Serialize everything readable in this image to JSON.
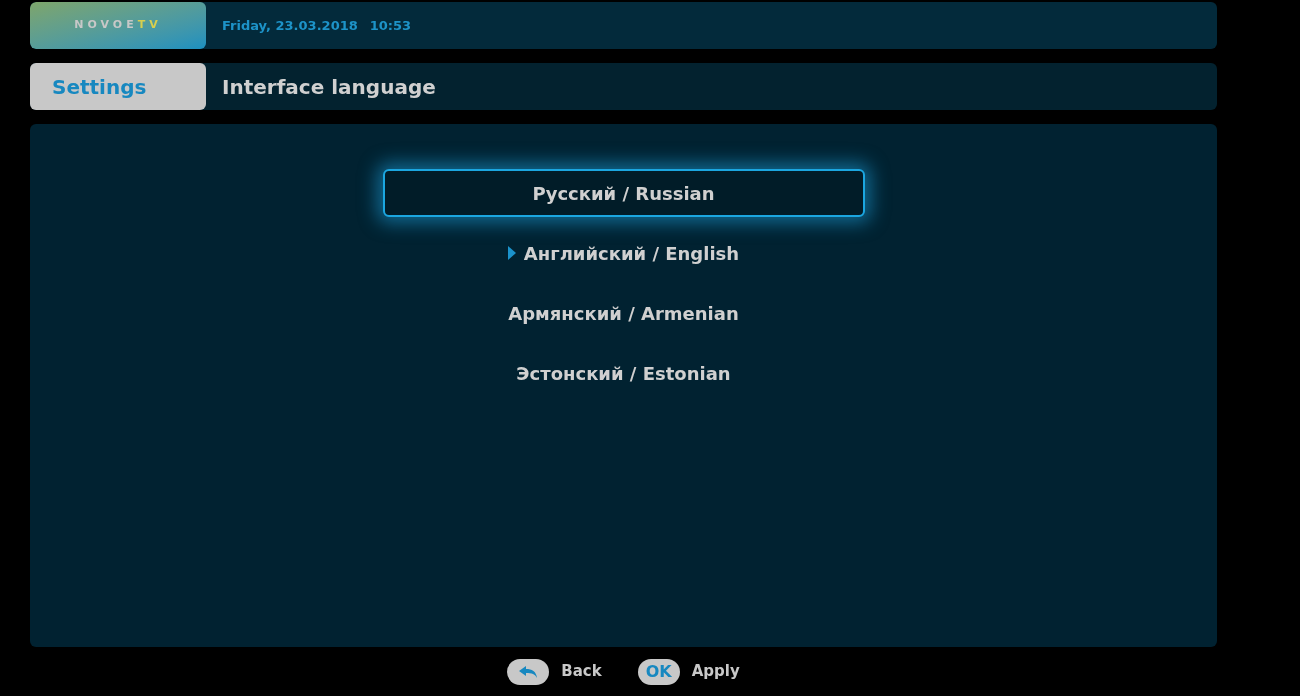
{
  "top_bar": {
    "logo": {
      "part_1": "NOVOE",
      "part_2": "TV"
    },
    "date": "Friday, 23.03.2018",
    "time": "10:53"
  },
  "header": {
    "section": "Settings",
    "title": "Interface language"
  },
  "languages": [
    {
      "label": "Русский / Russian",
      "focused": true,
      "current": false
    },
    {
      "label": "Английский / English",
      "focused": false,
      "current": true
    },
    {
      "label": "Армянский / Armenian",
      "focused": false,
      "current": false
    },
    {
      "label": "Эстонский / Estonian",
      "focused": false,
      "current": false
    }
  ],
  "hints": [
    {
      "kind": "back",
      "label": "Back"
    },
    {
      "kind": "ok",
      "key": "OK",
      "label": "Apply"
    }
  ]
}
